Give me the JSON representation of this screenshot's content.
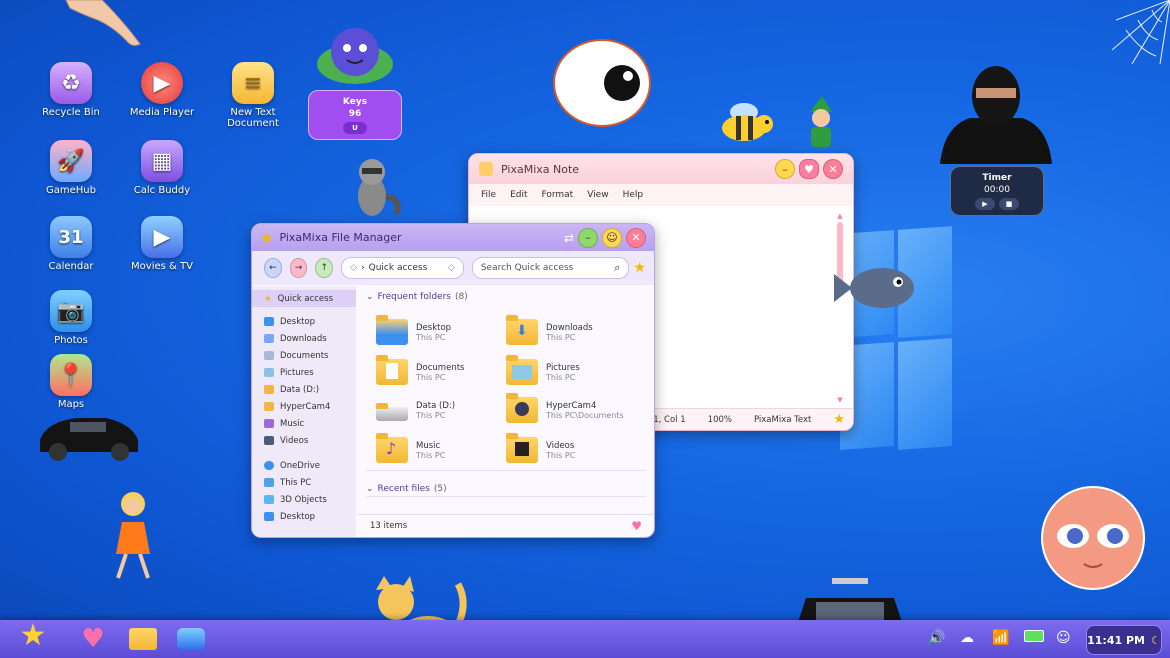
{
  "desktop_icons": [
    {
      "label": "Recycle Bin",
      "icon": "recycle-bin-icon"
    },
    {
      "label": "Media Player",
      "icon": "media-player-icon"
    },
    {
      "label": "New Text Document",
      "icon": "text-document-icon"
    },
    {
      "label": "GameHub",
      "icon": "rocket-icon"
    },
    {
      "label": "Calc Buddy",
      "icon": "calculator-icon"
    },
    {
      "label": "Calendar",
      "icon": "calendar-icon",
      "badge": "31"
    },
    {
      "label": "Movies & TV",
      "icon": "movies-icon"
    },
    {
      "label": "Photos",
      "icon": "camera-icon"
    },
    {
      "label": "Maps",
      "icon": "map-icon"
    }
  ],
  "keys_widget": {
    "title": "Keys",
    "value": "96",
    "key": "U"
  },
  "timer_widget": {
    "title": "Timer",
    "value": "00:00"
  },
  "file_manager": {
    "title": "PixaMixa File Manager",
    "address": "Quick access",
    "search_placeholder": "Search Quick access",
    "sidebar": [
      "Quick access",
      "Desktop",
      "Downloads",
      "Documents",
      "Pictures",
      "Data (D:)",
      "HyperCam4",
      "Music",
      "Videos",
      "OneDrive",
      "This PC",
      "3D Objects",
      "Desktop"
    ],
    "frequent_label": "Frequent folders",
    "frequent_count": "(8)",
    "folders": [
      {
        "name": "Desktop",
        "loc": "This PC"
      },
      {
        "name": "Downloads",
        "loc": "This PC"
      },
      {
        "name": "Documents",
        "loc": "This PC"
      },
      {
        "name": "Pictures",
        "loc": "This PC"
      },
      {
        "name": "Data (D:)",
        "loc": "This PC"
      },
      {
        "name": "HyperCam4",
        "loc": "This PC\\Documents"
      },
      {
        "name": "Music",
        "loc": "This PC"
      },
      {
        "name": "Videos",
        "loc": "This PC"
      }
    ],
    "recent_label": "Recent files",
    "recent_count": "(5)",
    "status": "13 items"
  },
  "note": {
    "title": "PixaMixa Note",
    "menu": [
      "File",
      "Edit",
      "Format",
      "View",
      "Help"
    ],
    "status_pos": "Ln 1, Col 1",
    "status_zoom": "100%",
    "status_type": "PixaMixa Text"
  },
  "taskbar": {
    "clock": "11:41 PM",
    "apps": [
      "star-icon",
      "heart-icon",
      "folder-icon",
      "camera-icon"
    ],
    "tray": [
      "volume-icon",
      "cloud-icon",
      "wifi-icon",
      "battery-icon",
      "user-icon"
    ]
  },
  "colors": {
    "accent": "#7d6cf0",
    "fm_title": "#b79ff0",
    "note_title": "#fbd2db",
    "desktop": "#1769e4"
  }
}
